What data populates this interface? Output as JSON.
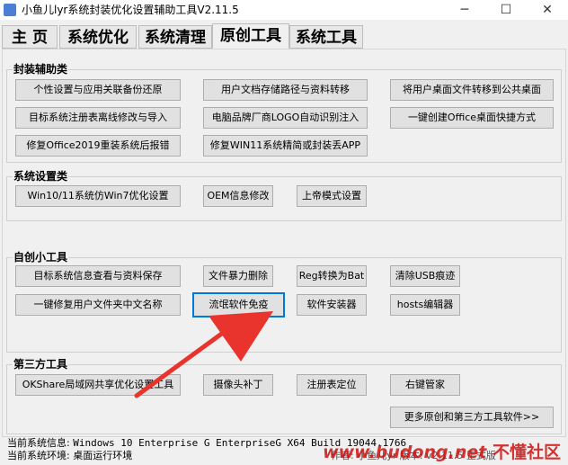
{
  "window": {
    "title": "小鱼儿lyr系统封装优化设置辅助工具V2.11.5",
    "minimize_glyph": "─",
    "maximize_glyph": "☐",
    "close_glyph": "✕"
  },
  "tabs": [
    {
      "label": "主 页",
      "active": false
    },
    {
      "label": "系统优化",
      "active": false
    },
    {
      "label": "系统清理",
      "active": false
    },
    {
      "label": "原创工具",
      "active": true
    },
    {
      "label": "系统工具",
      "active": false
    }
  ],
  "groups": {
    "packaging": {
      "title": "封装辅助类",
      "buttons": [
        "个性设置与应用关联备份还原",
        "用户文档存储路径与资料转移",
        "将用户桌面文件转移到公共桌面",
        "目标系统注册表离线修改与导入",
        "电脑品牌厂商LOGO自动识别注入",
        "一键创建Office桌面快捷方式",
        "修复Office2019重装系统后报错",
        "修复WIN11系统精简或封装丢APP"
      ]
    },
    "settings": {
      "title": "系统设置类",
      "buttons": [
        "Win10/11系统仿Win7优化设置",
        "OEM信息修改",
        "上帝模式设置"
      ]
    },
    "original": {
      "title": "自创小工具",
      "buttons": [
        "目标系统信息查看与资料保存",
        "文件暴力删除",
        "Reg转换为Bat",
        "清除USB痕迹",
        "一键修复用户文件夹中文名称",
        "流氓软件免疫",
        "软件安装器",
        "hosts编辑器"
      ]
    },
    "thirdparty": {
      "title": "第三方工具",
      "buttons": [
        "OKShare局域网共享优化设置工具",
        "摄像头补丁",
        "注册表定位",
        "右键管家"
      ]
    }
  },
  "more_button": "更多原创和第三方工具软件>>",
  "status": {
    "system_info_label": "当前系统信息:",
    "system_info_value": "Windows 10 Enterprise G EnterpriseG X64 Build 19044.1766",
    "env_label": "当前系统环境:",
    "env_value": "桌面运行环境",
    "author_text": "作者: 小鱼儿yr  版本: v2.11.5 正式版"
  },
  "watermark": {
    "site": "www.budong.net",
    "name": "不懂社区"
  },
  "colors": {
    "focus_border": "#0078d7",
    "arrow": "#e8342c",
    "watermark": "#cc1111"
  },
  "icons": {
    "app": "app-icon",
    "arrow": "red-arrow-annotation"
  }
}
